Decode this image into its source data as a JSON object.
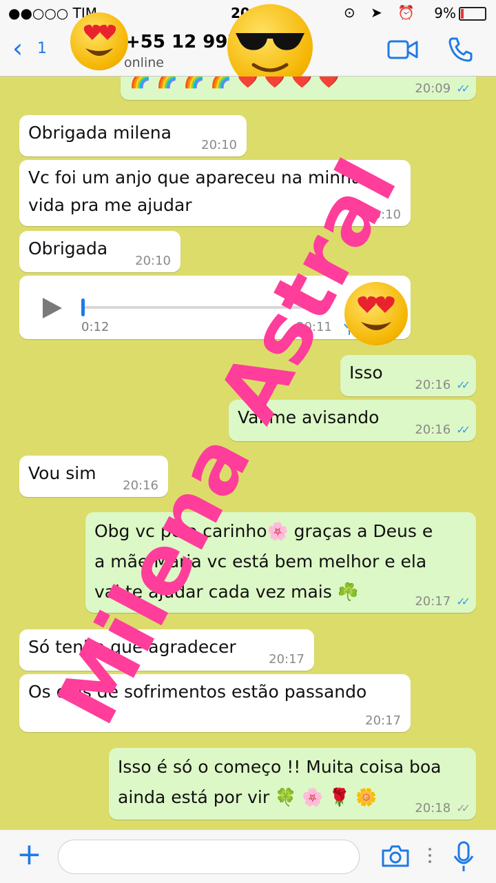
{
  "status_bar": {
    "carrier": "●●○○○ TIM",
    "time": "20:",
    "battery": "9%"
  },
  "header": {
    "back_icon": "chevron-left-icon",
    "back_count": "1",
    "contact": "+55 12 9978",
    "presence": "online"
  },
  "messages": [
    {
      "dir": "out",
      "text": "🌈 🌈 🌈 🌈 ❤️ ❤️ ❤️ ❤️",
      "time": "20:09",
      "ticks": "✓✓"
    },
    {
      "dir": "in",
      "text": "Obrigada milena",
      "time": "20:10"
    },
    {
      "dir": "in",
      "text": "Vc foi um anjo que apareceu na minha",
      "text2": "vida pra me ajudar",
      "time": "20:10"
    },
    {
      "dir": "in",
      "text": "Obrigada",
      "time": "20:10"
    },
    {
      "dir": "in",
      "audio": true,
      "duration": "0:12",
      "time": "20:11"
    },
    {
      "dir": "out",
      "text": "Isso",
      "time": "20:16",
      "ticks": "✓✓"
    },
    {
      "dir": "out",
      "text": "Vai me avisando",
      "time": "20:16",
      "ticks": "✓✓"
    },
    {
      "dir": "in",
      "text": "Vou sim",
      "time": "20:16"
    },
    {
      "dir": "out",
      "text": "Obg vc pelo carinho🌸  graças a Deus e",
      "text2": "a mãe Maria vc está bem melhor e ela",
      "text3": "vai te ajudar cada vez mais ☘️",
      "time": "20:17",
      "ticks": "✓✓"
    },
    {
      "dir": "in",
      "text": "Só tenho que agradecer",
      "time": "20:17"
    },
    {
      "dir": "in",
      "text": "Os dias de sofrimentos estão passando",
      "time": "20:17"
    },
    {
      "dir": "out",
      "text": "Isso é só o começo !! Muita coisa boa",
      "text2": "ainda está por vir 🍀 🌸 🌹 🌼",
      "time": "20:18",
      "ticks": "✓✓"
    }
  ],
  "watermark": "Milena Astral",
  "colors": {
    "chat_bg": "#dcdc6b",
    "incoming": "#ffffff",
    "outgoing": "#dcf8c6",
    "accent": "#1e7ae4",
    "watermark": "#ff3d9a"
  }
}
